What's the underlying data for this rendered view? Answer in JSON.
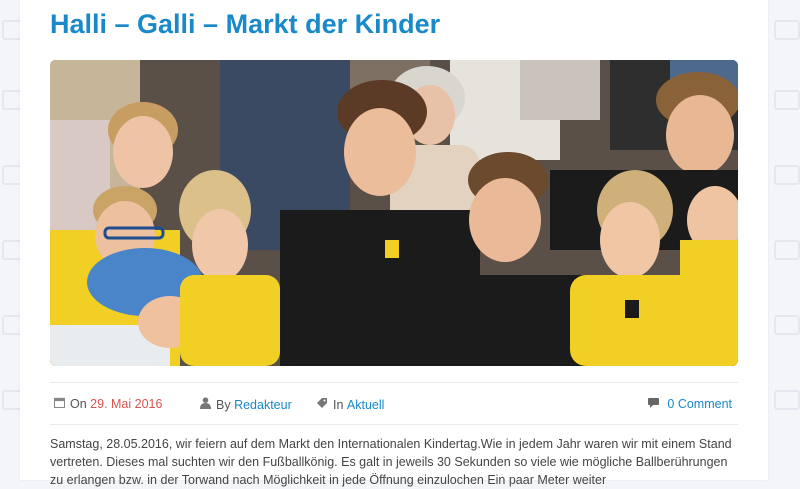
{
  "post": {
    "title": "Halli – Galli – Markt der Kinder",
    "image_alt": "Kinder in gelben und schwarzen T-Shirts auf dem Markt",
    "meta": {
      "date_prefix": "On",
      "date": "29. Mai 2016",
      "author_prefix": "By",
      "author": "Redakteur",
      "category_prefix": "In",
      "category": "Aktuell",
      "comments": "0 Comment"
    },
    "excerpt": "Samstag, 28.05.2016, wir feiern auf dem Markt den Internationalen Kindertag.Wie in jedem Jahr waren wir mit einem Stand vertreten. Dieses mal suchten wir den Fußballkönig. Es galt in jeweils 30 Sekunden so viele wie mögliche Ballberührungen zu erlangen bzw. in der Torwand nach Möglichkeit in jede Öffnung einzulochen Ein paar Meter weiter"
  },
  "icons": {
    "calendar": "calendar-icon",
    "author": "user-icon",
    "category": "tag-icon",
    "comments": "comment-icon"
  },
  "colors": {
    "accent": "#1a89c9",
    "date": "#d9534f",
    "shirt_yellow": "#f1cf24",
    "shirt_black": "#1b1b1b"
  }
}
